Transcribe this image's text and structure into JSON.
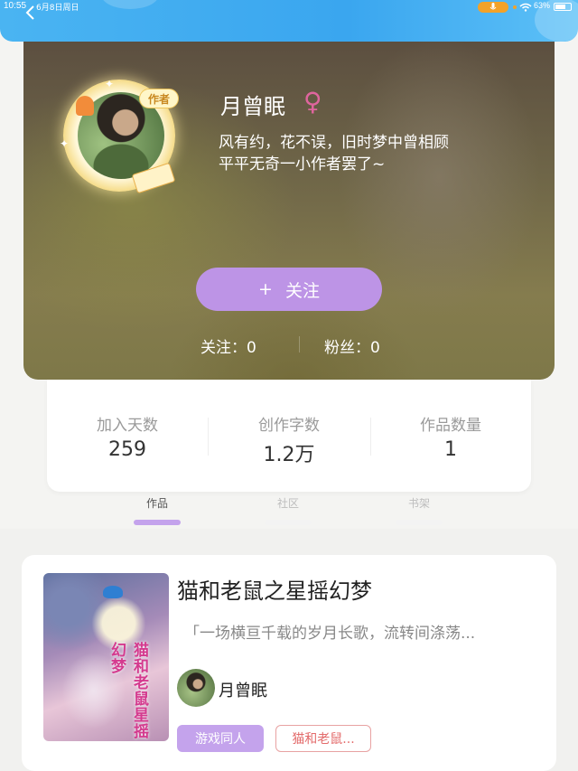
{
  "status_bar": {
    "time": "10:55",
    "date": "6月8日周日",
    "battery": "63%"
  },
  "profile": {
    "badge": "作者",
    "name": "月曾眠",
    "gender_symbol": "♀",
    "bio_line1": "风有约，花不误，旧时梦中曾相顾",
    "bio_line2": "平平无奇一小作者罢了~",
    "follow_button": {
      "icon": "+",
      "label": "关注"
    },
    "following": "关注：0",
    "fans": "粉丝：0"
  },
  "stats": [
    {
      "label": "加入天数",
      "value": "259"
    },
    {
      "label": "创作字数",
      "value": "1.2万"
    },
    {
      "label": "作品数量",
      "value": "1"
    }
  ],
  "tabs": [
    {
      "label": "作品",
      "active": true
    },
    {
      "label": "社区",
      "active": false
    },
    {
      "label": "书架",
      "active": false
    }
  ],
  "book": {
    "cover_text": "猫和老鼠星摇幻梦",
    "title": "猫和老鼠之星摇幻梦",
    "description": "「一场横亘千载的岁月长歌，流转间涤荡...",
    "author": "月曾眠",
    "tags": [
      "游戏同人",
      "猫和老鼠..."
    ]
  },
  "colors": {
    "header_blue": "#3aa6ef",
    "accent_purple": "#bd94e6",
    "gender_pink": "#e0659e",
    "tag_red": "#e36b6b"
  }
}
